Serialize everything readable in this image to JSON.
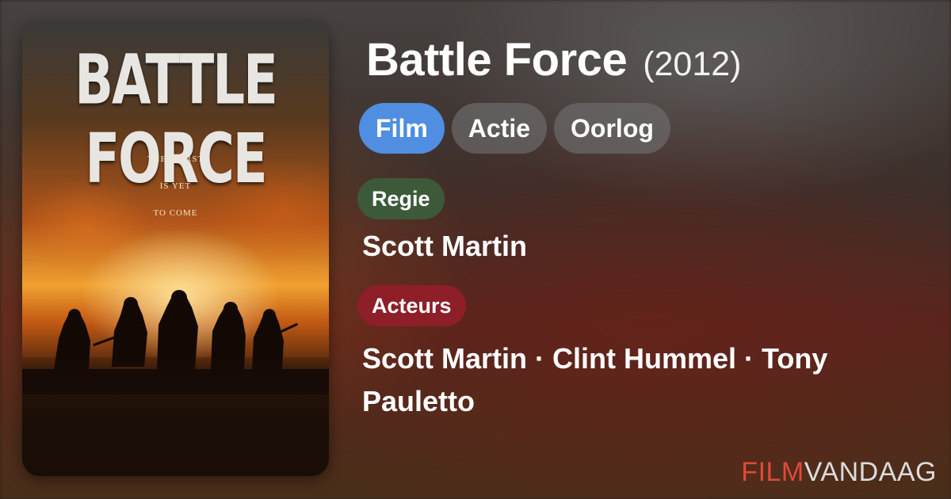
{
  "poster": {
    "title": "BATTLE FORCE",
    "tagline": [
      "THE WORST",
      "IS YET",
      "TO COME"
    ]
  },
  "movie": {
    "title": "Battle Force",
    "year": "(2012)"
  },
  "genres": [
    "Film",
    "Actie",
    "Oorlog"
  ],
  "active_genre": "Film",
  "labels": {
    "director": "Regie",
    "cast": "Acteurs"
  },
  "director": "Scott Martin",
  "cast": [
    "Scott Martin",
    "Clint Hummel",
    "Tony Pauletto"
  ],
  "separator": "·",
  "brand": {
    "part1": "FILM",
    "part2": "VANDAAG"
  },
  "colors": {
    "active_pill": "#4f8ee0",
    "pill": "#6e6e6e",
    "regie_label": "#3c5a3a",
    "acteurs_label": "#8e1e28",
    "brand_red": "#e04a3a"
  }
}
